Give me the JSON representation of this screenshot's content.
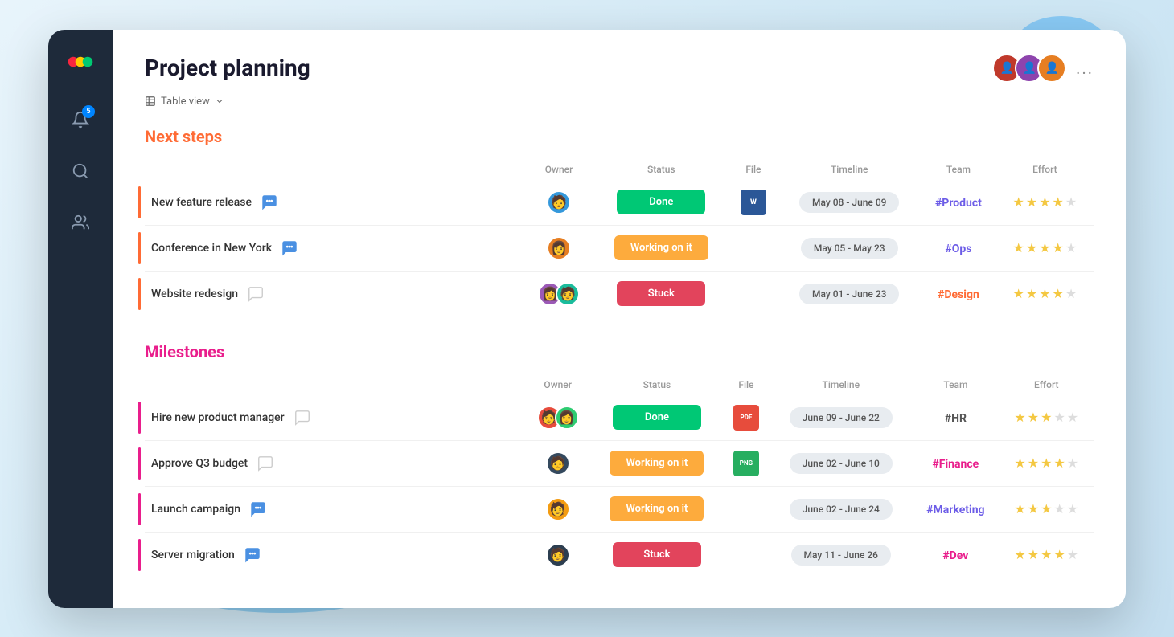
{
  "app": {
    "title": "Project planning",
    "view_label": "Table view",
    "logo": "monday-logo",
    "more_options": "...",
    "notification_badge": "5"
  },
  "sidebar": {
    "items": [
      {
        "name": "logo",
        "icon": "logo-icon"
      },
      {
        "name": "notifications",
        "icon": "bell-icon",
        "badge": "5"
      },
      {
        "name": "search",
        "icon": "search-icon"
      },
      {
        "name": "people",
        "icon": "people-icon"
      }
    ]
  },
  "sections": [
    {
      "id": "next-steps",
      "title": "Next steps",
      "type": "next-steps",
      "columns": [
        "Owner",
        "Status",
        "File",
        "Timeline",
        "Team",
        "Effort"
      ],
      "accent": "orange",
      "rows": [
        {
          "name": "New feature release",
          "has_chat": true,
          "chat_active": true,
          "owners": [
            "av1"
          ],
          "status": "Done",
          "status_type": "done",
          "has_file": true,
          "file_type": "word",
          "file_label": "W",
          "timeline": "May 08 - June 09",
          "team": "#Product",
          "team_class": "team-product",
          "stars": 4,
          "total_stars": 5
        },
        {
          "name": "Conference in New York",
          "has_chat": true,
          "chat_active": true,
          "owners": [
            "av2"
          ],
          "status": "Working on it",
          "status_type": "working",
          "has_file": false,
          "timeline": "May 05 - May 23",
          "team": "#Ops",
          "team_class": "team-ops",
          "stars": 4,
          "total_stars": 5
        },
        {
          "name": "Website redesign",
          "has_chat": true,
          "chat_active": false,
          "owners": [
            "av3",
            "av4"
          ],
          "status": "Stuck",
          "status_type": "stuck",
          "has_file": false,
          "timeline": "May 01 - June 23",
          "team": "#Design",
          "team_class": "team-design",
          "stars": 4,
          "total_stars": 5
        }
      ]
    },
    {
      "id": "milestones",
      "title": "Milestones",
      "type": "milestones",
      "columns": [
        "Owner",
        "Status",
        "File",
        "Timeline",
        "Team",
        "Effort"
      ],
      "accent": "pink",
      "rows": [
        {
          "name": "Hire new product manager",
          "has_chat": true,
          "chat_active": false,
          "owners": [
            "av5",
            "av6"
          ],
          "status": "Done",
          "status_type": "done",
          "has_file": true,
          "file_type": "pdf",
          "file_label": "PDF",
          "timeline": "June 09 - June 22",
          "team": "#HR",
          "team_class": "team-hr",
          "stars": 3,
          "total_stars": 5
        },
        {
          "name": "Approve Q3 budget",
          "has_chat": true,
          "chat_active": false,
          "owners": [
            "av7"
          ],
          "status": "Working on it",
          "status_type": "working",
          "has_file": true,
          "file_type": "png",
          "file_label": "PNG",
          "timeline": "June 02 - June 10",
          "team": "#Finance",
          "team_class": "team-finance",
          "stars": 4,
          "total_stars": 5
        },
        {
          "name": "Launch campaign",
          "has_chat": true,
          "chat_active": true,
          "owners": [
            "av8"
          ],
          "status": "Working on it",
          "status_type": "working",
          "has_file": false,
          "timeline": "June 02 - June 24",
          "team": "#Marketing",
          "team_class": "team-marketing",
          "stars": 3,
          "total_stars": 5
        },
        {
          "name": "Server migration",
          "has_chat": true,
          "chat_active": true,
          "owners": [
            "av1"
          ],
          "status": "Stuck",
          "status_type": "stuck",
          "has_file": false,
          "timeline": "May 11 - June 26",
          "team": "#Dev",
          "team_class": "team-dev",
          "stars": 4,
          "total_stars": 5
        }
      ]
    }
  ]
}
